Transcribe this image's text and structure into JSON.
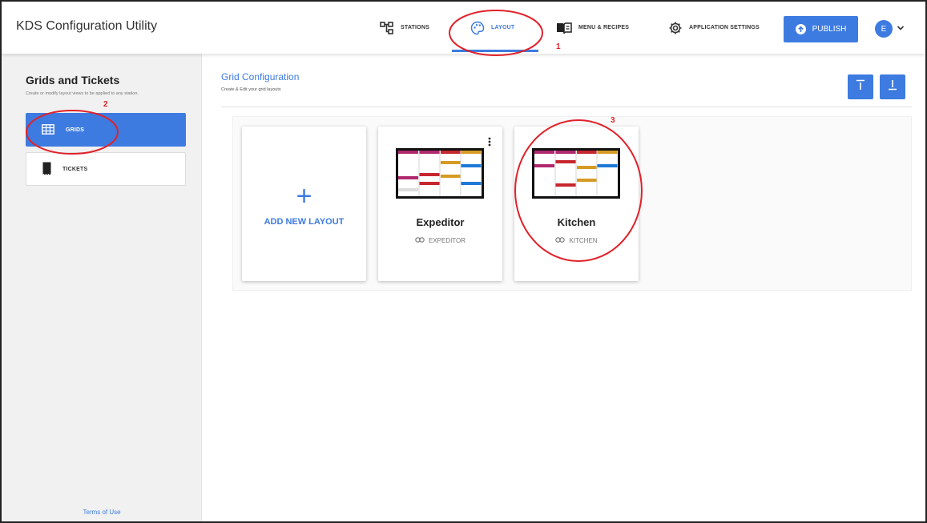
{
  "app": {
    "title": "KDS Configuration Utility"
  },
  "nav": {
    "stations": "STATIONS",
    "layout": "LAYOUT",
    "menu_recipes": "MENU & RECIPES",
    "app_settings": "APPLICATION SETTINGS",
    "publish": "PUBLISH"
  },
  "user": {
    "initial": "E"
  },
  "sidebar": {
    "title": "Grids and Tickets",
    "subtitle": "Create or modify layout views to be applied to any station.",
    "items": [
      {
        "label": "GRIDS",
        "icon": "grid-icon",
        "active": true
      },
      {
        "label": "TICKETS",
        "icon": "ticket-icon",
        "active": false
      }
    ],
    "terms": "Terms of Use"
  },
  "main": {
    "title": "Grid Configuration",
    "subtitle": "Create & Edit your grid layouts",
    "add_label": "ADD NEW LAYOUT",
    "add_symbol": "+",
    "cards": [
      {
        "name": "Expeditor",
        "tag": "EXPEDITOR"
      },
      {
        "name": "Kitchen",
        "tag": "KITCHEN"
      }
    ]
  },
  "annotations": {
    "n1": "1",
    "n2": "2",
    "n3": "3"
  },
  "colors": {
    "accent": "#3d7be0",
    "annotation": "#e1222a",
    "bar_magenta": "#b0296f",
    "bar_red": "#c6262f",
    "bar_gold": "#d69b24",
    "bar_blue": "#1e78d6"
  }
}
